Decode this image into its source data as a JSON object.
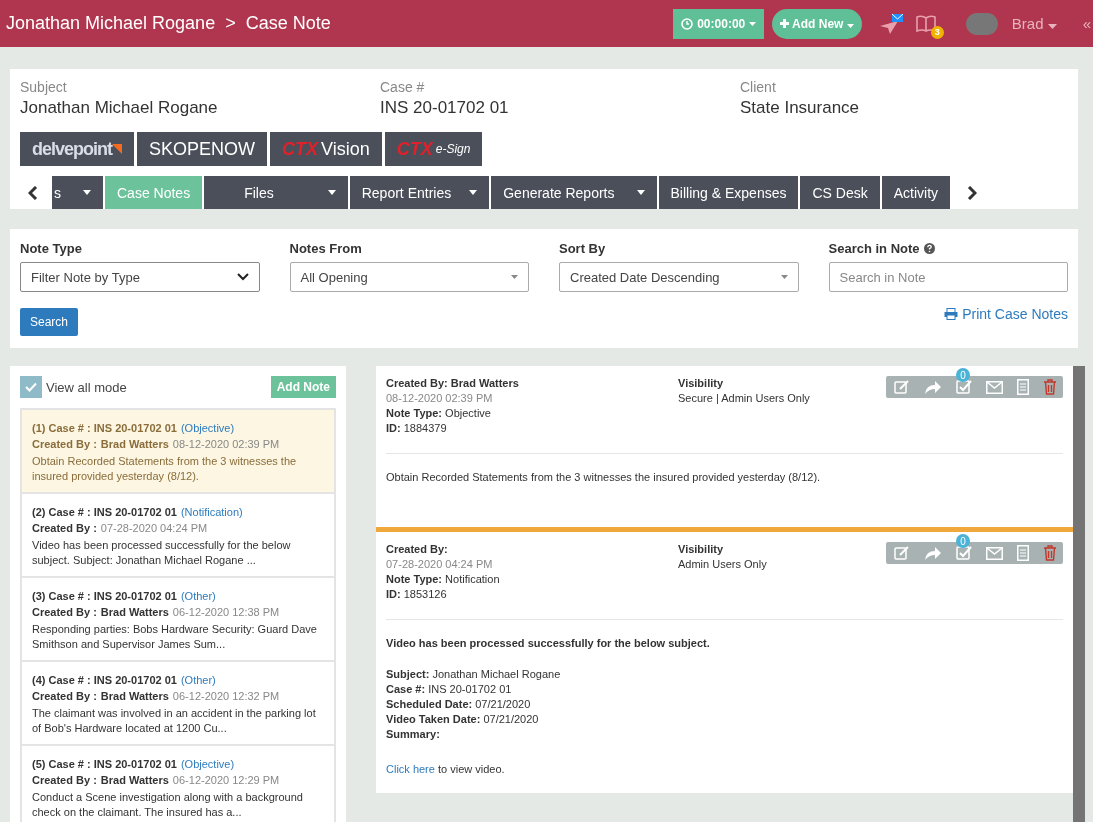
{
  "header": {
    "crumbs": [
      "Jonathan Michael Rogane",
      "Case Note"
    ],
    "separator": ">",
    "timer": "00:00:00",
    "add_new": "Add New",
    "notification_count": "3",
    "user": "Brad",
    "collapse": "«"
  },
  "case_info": [
    {
      "label": "Subject",
      "value": "Jonathan Michael Rogane"
    },
    {
      "label": "Case #",
      "value": "INS 20-01702 01"
    },
    {
      "label": "Client",
      "value": "State Insurance"
    }
  ],
  "brands": [
    {
      "kind": "delve",
      "text": "delvepoint"
    },
    {
      "kind": "plain",
      "text": "SKOPENOW"
    },
    {
      "kind": "ctx",
      "prefix": "CTX",
      "text": "Vision"
    },
    {
      "kind": "ctx-small",
      "prefix": "CTX",
      "text": "e-Sign"
    }
  ],
  "tabs": [
    {
      "label": "s",
      "selected": false,
      "dropdown": true
    },
    {
      "label": "Case Notes",
      "selected": true,
      "dropdown": false
    },
    {
      "label": "Files",
      "selected": false,
      "dropdown": true
    },
    {
      "label": "Report Entries",
      "selected": false,
      "dropdown": true
    },
    {
      "label": "Generate Reports",
      "selected": false,
      "dropdown": true
    },
    {
      "label": "Billing & Expenses",
      "selected": false,
      "dropdown": false
    },
    {
      "label": "CS Desk",
      "selected": false,
      "dropdown": false
    },
    {
      "label": "Activity",
      "selected": false,
      "dropdown": false
    }
  ],
  "filters": [
    {
      "label": "Note Type",
      "kind": "native-select",
      "value": "Filter Note by Type"
    },
    {
      "label": "Notes From",
      "kind": "select",
      "value": "All Opening"
    },
    {
      "label": "Sort By",
      "kind": "select",
      "value": "Created Date Descending"
    },
    {
      "label": "Search in Note",
      "kind": "search",
      "placeholder": "Search in Note",
      "help": true
    }
  ],
  "search_button": "Search",
  "print_link": "Print Case Notes",
  "list": {
    "view_all": {
      "label": "View all mode",
      "checked": true
    },
    "add_note": "Add Note",
    "items": [
      {
        "heading": "(1) Case # : INS 20-01702 01",
        "type": "(Objective)",
        "created_label": "Created By :",
        "author": "Brad Watters",
        "date": "08-12-2020 02:39 PM",
        "excerpt": "Obtain Recorded Statements from the 3 witnesses the insured provided yesterday (8/12).",
        "selected": true
      },
      {
        "heading": "(2) Case # : INS 20-01702 01",
        "type": "(Notification)",
        "created_label": "Created By :",
        "date": "07-28-2020 04:24 PM",
        "excerpt": "Video has been processed successfully for the below subject. Subject: Jonathan Michael Rogane ...",
        "selected": false
      },
      {
        "heading": "(3) Case # : INS 20-01702 01",
        "type": "(Other)",
        "created_label": "Created By :",
        "author": "Brad Watters",
        "date": "06-12-2020 12:38 PM",
        "excerpt": "Responding parties:  Bobs Hardware Security:  Guard Dave Smithson and Supervisor James Sum...",
        "selected": false
      },
      {
        "heading": "(4) Case # : INS 20-01702 01",
        "type": "(Other)",
        "created_label": "Created By :",
        "author": "Brad Watters",
        "date": "06-12-2020 12:32 PM",
        "excerpt": "The claimant was involved in an accident in the parking lot of Bob's Hardware located at 1200 Cu...",
        "selected": false
      },
      {
        "heading": "(5) Case # : INS 20-01702 01",
        "type": "(Objective)",
        "created_label": "Created By :",
        "author": "Brad Watters",
        "date": "06-12-2020 12:29 PM",
        "excerpt": "Conduct a Scene investigation along with a background check on the claimant.  The insured has a...",
        "selected": false
      }
    ]
  },
  "notes": [
    {
      "selected": true,
      "created": "**Created By:** **Brad Watters**",
      "date": "08-12-2020 02:39 PM",
      "note_type": "**Note Type:** Objective",
      "id": "**ID:** 1884379",
      "visibility_label": "Visibility",
      "visibility": "Secure | Admin Users Only",
      "badge": "0",
      "body": [
        {
          "kind": "paragraph",
          "text": "Obtain Recorded Statements from the 3 witnesses the insured provided yesterday (8/12)."
        }
      ]
    },
    {
      "selected": false,
      "created": "**Created By:**",
      "date": "07-28-2020 04:24 PM",
      "note_type": "**Note Type:** Notification",
      "id": "**ID:** 1853126",
      "visibility_label": "Visibility",
      "visibility": "Admin Users Only",
      "badge": "0",
      "body": [
        {
          "kind": "bold",
          "text": "Video has been processed successfully for the below subject."
        },
        {
          "kind": "fields",
          "lines": [
            "**Subject:** Jonathan Michael Rogane",
            "**Case #:** INS 20-01702 01",
            "**Scheduled Date:** 07/21/2020",
            "**Video Taken Date:** 07/21/2020",
            "**Summary:**"
          ]
        },
        {
          "kind": "link",
          "link": "Click here",
          "text": "to view video."
        }
      ]
    }
  ]
}
